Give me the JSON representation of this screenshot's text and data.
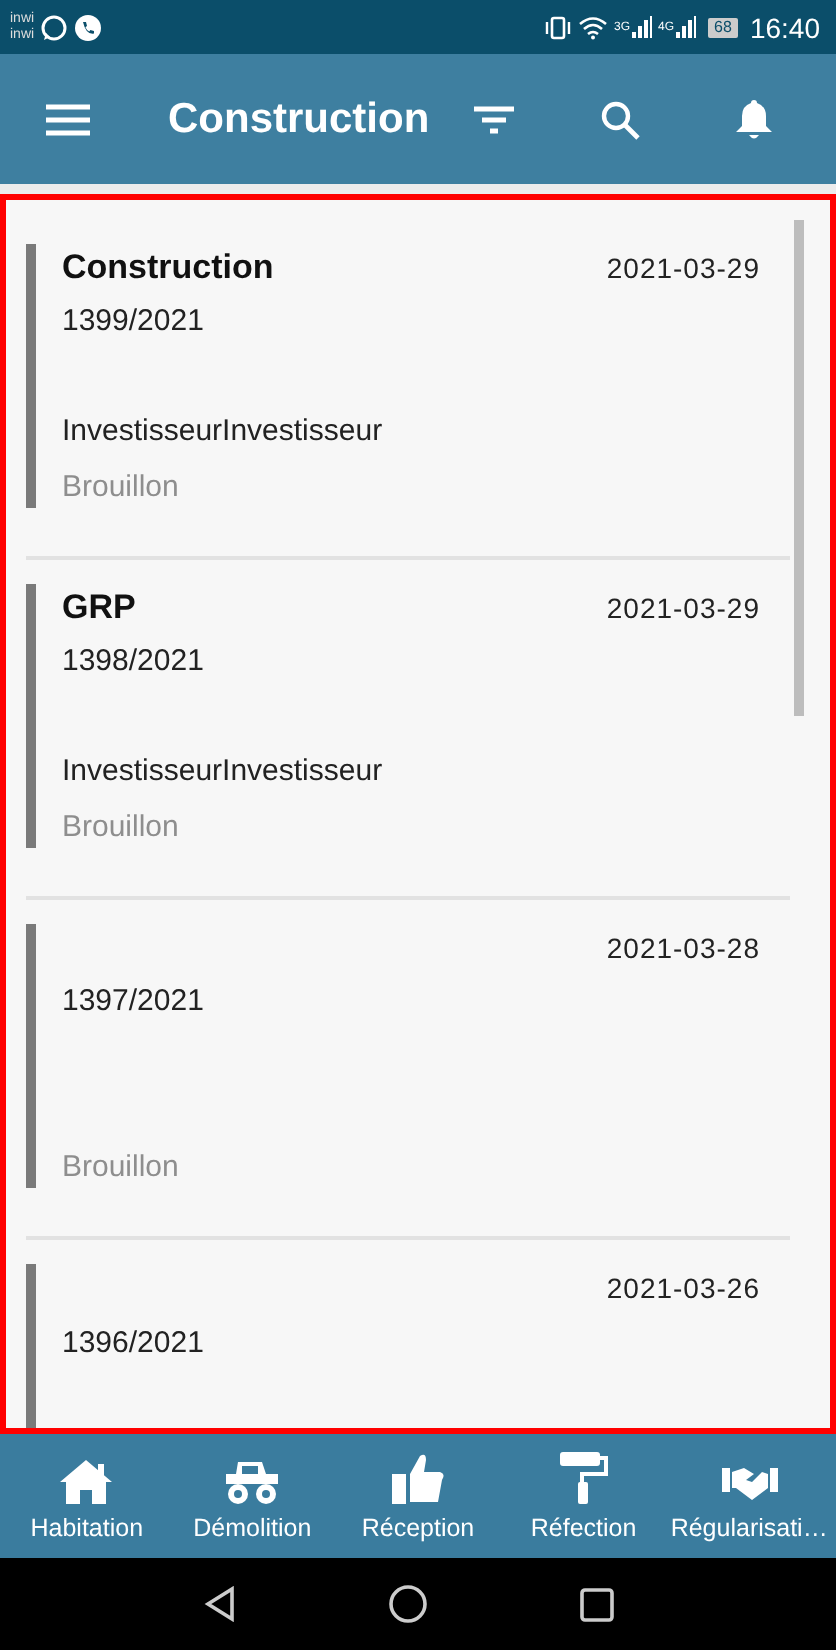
{
  "status_bar": {
    "carriers": [
      "inwi",
      "inwi"
    ],
    "network_labels": [
      "3G",
      "4G"
    ],
    "battery": "68",
    "time": "16:40"
  },
  "app_bar": {
    "title": "Construction"
  },
  "list": {
    "highlighted": true,
    "items": [
      {
        "title": "Construction",
        "date": "2021-03-29",
        "number": "1399/2021",
        "investor": "InvestisseurInvestisseur",
        "status": "Brouillon"
      },
      {
        "title": "GRP",
        "date": "2021-03-29",
        "number": "1398/2021",
        "investor": "InvestisseurInvestisseur",
        "status": "Brouillon"
      },
      {
        "date": "2021-03-28",
        "number": "1397/2021",
        "status": "Brouillon"
      },
      {
        "date": "2021-03-26",
        "number": "1396/2021"
      }
    ]
  },
  "bottom_nav": [
    {
      "kind": "house",
      "label": "Habitation"
    },
    {
      "kind": "truck",
      "label": "Démolition"
    },
    {
      "kind": "thumb",
      "label": "Réception"
    },
    {
      "kind": "roller",
      "label": "Réfection"
    },
    {
      "kind": "handshake",
      "label": "Régularisati…"
    }
  ]
}
